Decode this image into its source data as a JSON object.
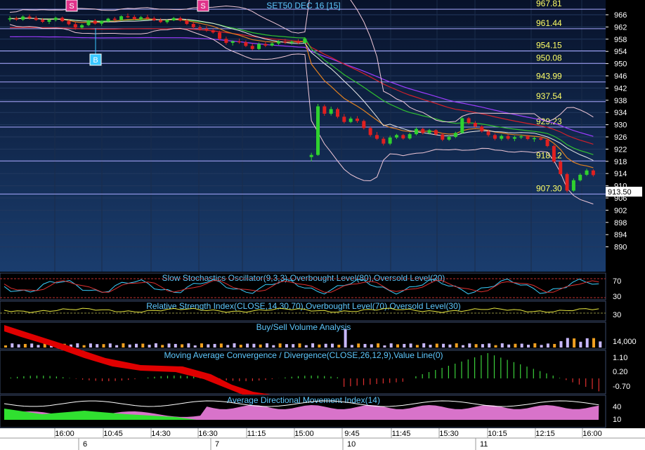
{
  "chart_title": "SET50 DEC 16  [15]",
  "colors": {
    "bg_top": "#08122a",
    "bg_bottom": "#1a3d6e",
    "panel_bg": "#000000",
    "level_line": "#a9a8ff",
    "level_text": "#ffff66",
    "axis_text": "#ffffff",
    "panel_title": "#5ec8ff",
    "candle_up": "#2fd12f",
    "candle_down": "#e02020",
    "last_price_bg": "#ffffff",
    "signal_sell": "#e0338a",
    "signal_buy": "#3ac8ff"
  },
  "price_panel": {
    "y_ticks": [
      "966",
      "962",
      "958",
      "954",
      "950",
      "946",
      "942",
      "938",
      "934",
      "930",
      "926",
      "922",
      "918",
      "914",
      "910",
      "906",
      "902",
      "898",
      "894",
      "890"
    ],
    "levels": [
      "967.81",
      "961.44",
      "954.15",
      "950.08",
      "943.99",
      "937.54",
      "929.23",
      "918.12",
      "907.30"
    ],
    "last_price": "913.50",
    "signals": [
      {
        "label": "S",
        "kind": "sell"
      },
      {
        "label": "S",
        "kind": "sell"
      },
      {
        "label": "B",
        "kind": "buy"
      }
    ],
    "candles": [
      [
        964.6,
        965.6,
        963.8,
        964.8
      ],
      [
        964.8,
        965.4,
        964.0,
        964.4
      ],
      [
        964.4,
        965.8,
        964.0,
        965.4
      ],
      [
        965.4,
        966.1,
        964.4,
        964.9
      ],
      [
        964.9,
        965.6,
        964.0,
        964.3
      ],
      [
        964.3,
        964.9,
        963.3,
        963.7
      ],
      [
        963.7,
        964.6,
        963.0,
        964.3
      ],
      [
        964.3,
        965.4,
        963.8,
        965.0
      ],
      [
        965.0,
        965.4,
        963.6,
        963.9
      ],
      [
        963.9,
        964.4,
        962.5,
        962.9
      ],
      [
        962.9,
        963.6,
        961.1,
        961.8
      ],
      [
        961.8,
        963.0,
        961.4,
        962.6
      ],
      [
        962.6,
        964.4,
        962.3,
        964.0
      ],
      [
        964.0,
        964.6,
        962.7,
        963.1
      ],
      [
        963.1,
        964.1,
        962.4,
        963.8
      ],
      [
        963.8,
        965.0,
        963.4,
        964.7
      ],
      [
        964.7,
        965.3,
        963.9,
        964.3
      ],
      [
        964.3,
        965.8,
        964.0,
        965.5
      ],
      [
        965.5,
        966.4,
        964.9,
        965.3
      ],
      [
        965.3,
        965.9,
        964.2,
        964.6
      ],
      [
        964.6,
        965.6,
        964.1,
        965.2
      ],
      [
        965.2,
        966.0,
        964.4,
        964.8
      ],
      [
        964.8,
        965.4,
        963.9,
        964.2
      ],
      [
        964.2,
        964.9,
        963.3,
        963.6
      ],
      [
        963.6,
        964.5,
        963.1,
        964.2
      ],
      [
        964.2,
        965.3,
        963.9,
        964.9
      ],
      [
        964.9,
        965.4,
        963.8,
        964.1
      ],
      [
        964.1,
        964.6,
        962.6,
        963.0
      ],
      [
        963.0,
        963.5,
        961.4,
        961.9
      ],
      [
        961.9,
        962.6,
        960.8,
        961.4
      ],
      [
        961.4,
        962.3,
        960.4,
        960.9
      ],
      [
        960.9,
        961.4,
        959.8,
        960.2
      ],
      [
        960.2,
        960.8,
        957.6,
        958.1
      ],
      [
        958.1,
        958.8,
        956.2,
        956.8
      ],
      [
        956.8,
        957.6,
        955.9,
        957.3
      ],
      [
        957.3,
        958.2,
        956.5,
        957.0
      ],
      [
        957.0,
        957.6,
        955.4,
        955.8
      ],
      [
        955.8,
        956.6,
        954.4,
        954.8
      ],
      [
        954.8,
        956.9,
        954.5,
        956.4
      ],
      [
        956.4,
        957.3,
        955.4,
        955.9
      ],
      [
        955.9,
        957.0,
        955.6,
        956.6
      ],
      [
        956.6,
        957.7,
        956.1,
        957.3
      ],
      [
        957.3,
        958.1,
        956.4,
        956.9
      ],
      [
        956.9,
        957.6,
        956.2,
        957.2
      ],
      [
        957.2,
        958.0,
        956.4,
        956.8
      ],
      [
        956.8,
        958.6,
        956.5,
        958.2
      ],
      [
        919.4,
        920.8,
        918.0,
        920.1
      ],
      [
        920.1,
        936.8,
        919.8,
        936.0
      ],
      [
        936.0,
        936.6,
        932.9,
        933.6
      ],
      [
        933.6,
        935.9,
        933.0,
        935.1
      ],
      [
        935.1,
        935.6,
        932.1,
        932.6
      ],
      [
        932.6,
        933.5,
        930.4,
        930.9
      ],
      [
        930.9,
        932.6,
        930.5,
        932.0
      ],
      [
        932.0,
        932.8,
        930.6,
        931.2
      ],
      [
        931.2,
        931.7,
        928.4,
        928.9
      ],
      [
        928.9,
        929.5,
        926.1,
        926.6
      ],
      [
        926.6,
        927.6,
        925.0,
        925.4
      ],
      [
        925.4,
        926.0,
        923.2,
        923.8
      ],
      [
        923.8,
        926.4,
        923.3,
        925.8
      ],
      [
        925.8,
        927.0,
        925.3,
        926.6
      ],
      [
        926.6,
        927.0,
        925.1,
        925.5
      ],
      [
        925.5,
        927.4,
        925.1,
        926.9
      ],
      [
        926.9,
        929.2,
        926.5,
        928.6
      ],
      [
        928.6,
        929.0,
        926.8,
        927.3
      ],
      [
        927.3,
        928.6,
        926.8,
        928.2
      ],
      [
        928.2,
        928.5,
        926.4,
        926.8
      ],
      [
        926.8,
        927.3,
        924.6,
        925.1
      ],
      [
        925.1,
        926.5,
        924.7,
        926.0
      ],
      [
        926.0,
        927.7,
        925.6,
        927.3
      ],
      [
        927.3,
        932.6,
        927.0,
        932.1
      ],
      [
        932.1,
        932.5,
        930.1,
        930.6
      ],
      [
        930.6,
        931.2,
        928.9,
        929.4
      ],
      [
        929.4,
        929.8,
        927.4,
        927.8
      ],
      [
        927.8,
        928.4,
        926.1,
        926.6
      ],
      [
        926.6,
        927.1,
        924.9,
        925.4
      ],
      [
        925.4,
        926.8,
        924.8,
        926.3
      ],
      [
        926.3,
        926.9,
        924.9,
        925.4
      ],
      [
        925.4,
        926.4,
        924.6,
        925.9
      ],
      [
        925.9,
        926.7,
        925.3,
        926.2
      ],
      [
        926.2,
        926.7,
        924.9,
        925.3
      ],
      [
        925.3,
        926.0,
        924.4,
        925.6
      ],
      [
        925.6,
        926.2,
        924.8,
        925.1
      ],
      [
        925.1,
        925.6,
        922.6,
        923.0
      ],
      [
        923.0,
        923.5,
        917.4,
        917.9
      ],
      [
        917.9,
        918.4,
        913.3,
        913.8
      ],
      [
        913.8,
        914.3,
        907.8,
        908.4
      ],
      [
        908.4,
        912.4,
        908.0,
        911.8
      ],
      [
        911.8,
        914.1,
        911.4,
        913.6
      ],
      [
        913.6,
        915.6,
        913.2,
        915.0
      ],
      [
        915.0,
        915.4,
        913.0,
        913.5
      ]
    ]
  },
  "stoch_panel": {
    "title": "Slow Stochastics Oscillator(9,3,3),Overbought Level(80),Oversold Level(20)",
    "ticks": [
      "70",
      "30"
    ]
  },
  "rsi_panel": {
    "title": "Relative Strength Index(CLOSE,14,30,70),Overbought Level(70),Oversold Level(30)",
    "ticks": [
      "30"
    ]
  },
  "volume_panel": {
    "title": "Buy/Sell Volume Analysis",
    "ticks": [
      "14,000"
    ]
  },
  "macd_panel": {
    "title": "Moving Average Convergence / Divergence(CLOSE,26,12,9),Value Line(0)",
    "ticks": [
      "1.10",
      "0.20",
      "-0.70"
    ]
  },
  "adx_panel": {
    "title": "Average Directional Movement Index(14)",
    "ticks": [
      "40",
      "10"
    ]
  },
  "time_axis": {
    "times": [
      "16:00",
      "10:45",
      "14:30",
      "16:30",
      "11:15",
      "15:00",
      "9:45",
      "11:45",
      "15:30",
      "10:15",
      "12:15",
      "16:00"
    ],
    "dates": [
      "6",
      "7",
      "10",
      "11"
    ]
  }
}
